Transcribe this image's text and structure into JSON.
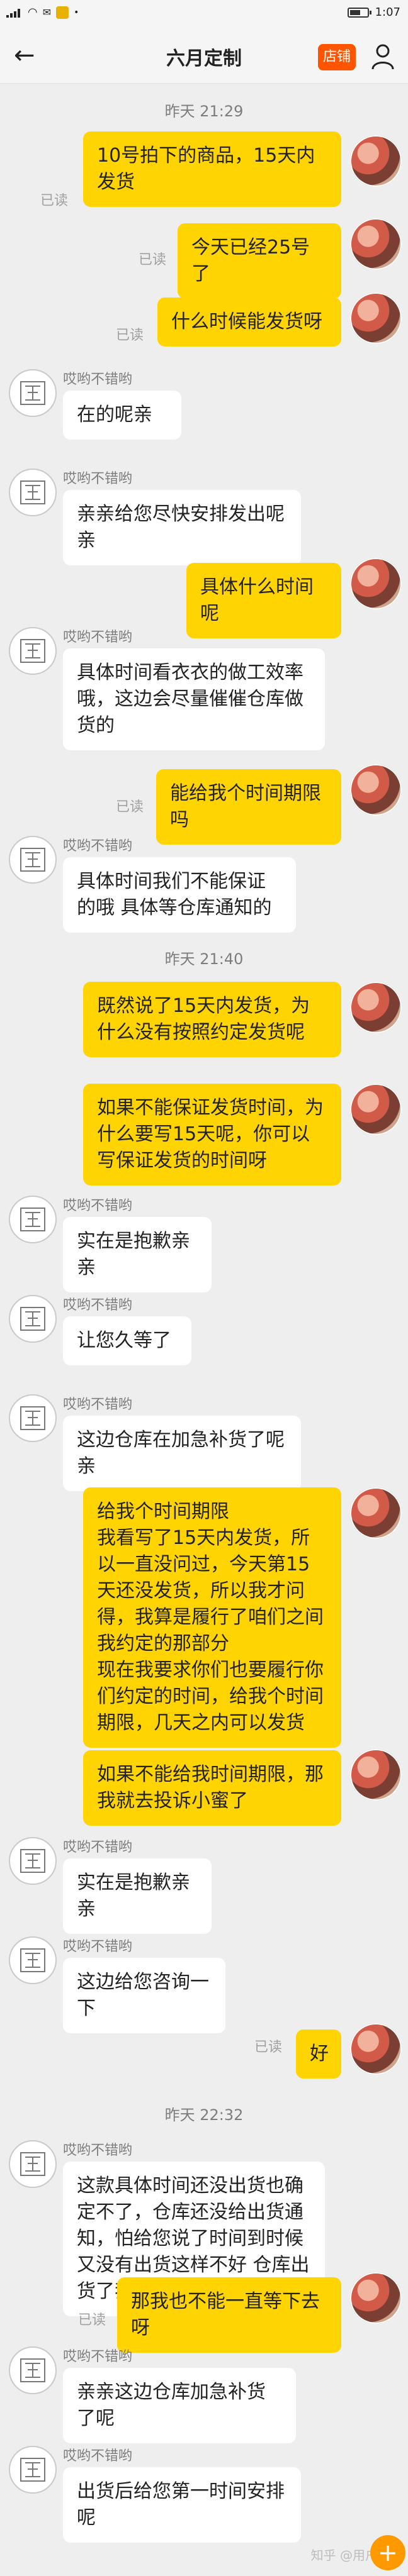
{
  "status_bar": {
    "left_icons": [
      "signal-icon",
      "wifi-icon",
      "notification-icon",
      "alipay-icon",
      "dot-icon"
    ],
    "battery_level_percent": 62,
    "time": "1:07"
  },
  "header": {
    "title": "六月定制",
    "shop_button": "店铺",
    "back_icon": "back-icon",
    "user_icon": "user-icon"
  },
  "merchant_name": "哎哟不错哟",
  "read_label": "已读",
  "time_labels": [
    "昨天 21:29",
    "昨天 21:40",
    "昨天 22:32"
  ],
  "messages": [
    {
      "from": "me",
      "text": "10号拍下的商品，15天内发货"
    },
    {
      "from": "me",
      "text": "今天已经25号了"
    },
    {
      "from": "me",
      "text": "什么时候能发货呀"
    },
    {
      "from": "merchant",
      "text": "在的呢亲"
    },
    {
      "from": "merchant",
      "text": "亲亲给您尽快安排发出呢亲"
    },
    {
      "from": "me",
      "text": "具体什么时间呢"
    },
    {
      "from": "merchant",
      "text": "具体时间看衣衣的做工效率哦，这边会尽量催催仓库做货的"
    },
    {
      "from": "me",
      "text": "能给我个时间期限吗"
    },
    {
      "from": "merchant",
      "text": "具体时间我们不能保证的哦 具体等仓库通知的"
    },
    {
      "from": "me",
      "text": "既然说了15天内发货，为什么没有按照约定发货呢"
    },
    {
      "from": "me",
      "text": "如果不能保证发货时间，为什么要写15天呢，你可以写保证发货的时间呀"
    },
    {
      "from": "merchant",
      "text": "实在是抱歉亲亲"
    },
    {
      "from": "merchant",
      "text": "让您久等了"
    },
    {
      "from": "merchant",
      "text": "这边仓库在加急补货了呢亲"
    },
    {
      "from": "me",
      "text": "给我个时间期限\n我看写了15天内发货，所以一直没问过，今天第15天还没发货，所以我才问得，我算是履行了咱们之间我约定的那部分\n现在我要求你们也要履行你们约定的时间，给我个时间期限，几天之内可以发货"
    },
    {
      "from": "me",
      "text": "如果不能给我时间期限，那我就去投诉小蜜了"
    },
    {
      "from": "merchant",
      "text": "实在是抱歉亲亲"
    },
    {
      "from": "merchant",
      "text": "这边给您咨询一下"
    },
    {
      "from": "me",
      "text": "好"
    },
    {
      "from": "merchant",
      "text": "这款具体时间还没出货也确定不了，仓库还没给出货通知，怕给您说了时间到时候又没有出货这样不好 仓库出货了我们第一时间给您发出"
    },
    {
      "from": "me",
      "text": "那我也不能一直等下去呀"
    },
    {
      "from": "merchant",
      "text": "亲亲这边仓库加急补货了呢"
    },
    {
      "from": "merchant",
      "text": "出货后给您第一时间安排呢"
    }
  ],
  "watermark": "知乎 @用户",
  "fab_icon": "plus-icon"
}
